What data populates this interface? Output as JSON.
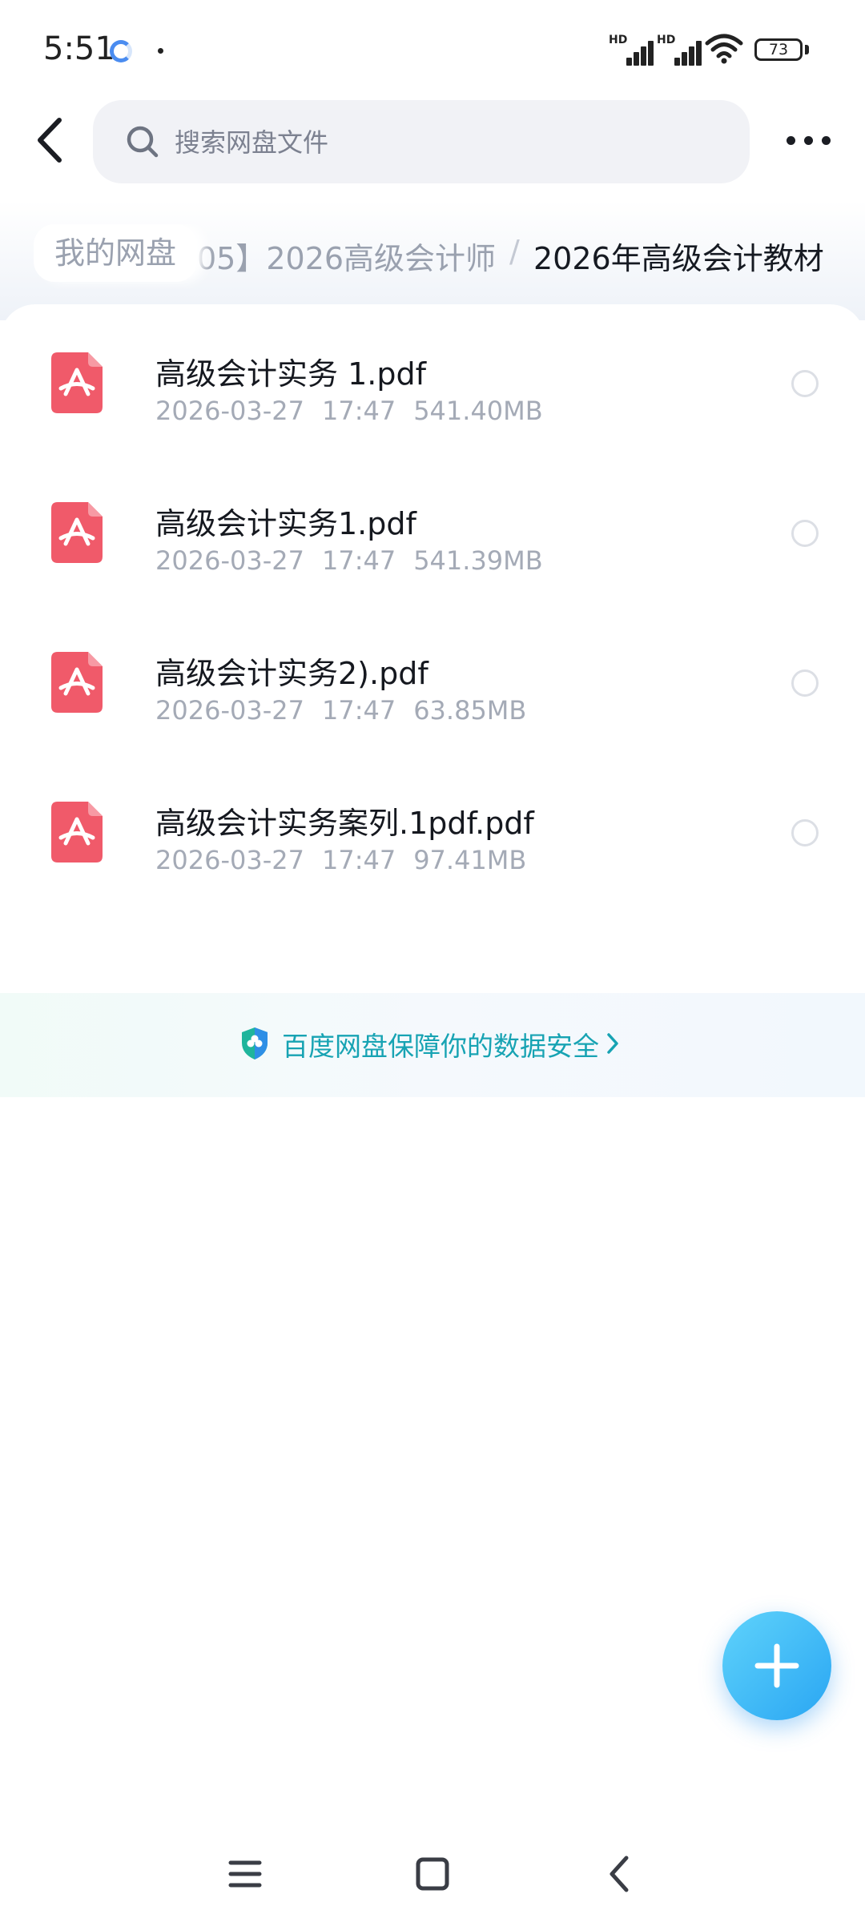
{
  "status_bar": {
    "time": "5:51",
    "signal_1_label": "HD",
    "signal_2_label": "HD",
    "battery": "73",
    "icons": [
      "loading-ring-icon",
      "notification-dot-icon",
      "signal-icon",
      "signal-icon",
      "wifi-icon",
      "battery-icon"
    ]
  },
  "header": {
    "back_icon": "chevron-left-icon",
    "search_placeholder": "搜索网盘文件",
    "search_icon": "search-icon",
    "more_icon": "more-horizontal-icon"
  },
  "breadcrumb": {
    "root": "我的网盘",
    "middle": "05】2026高级会计师",
    "separator": "/",
    "current": "2026年高级会计教材"
  },
  "files": [
    {
      "name": "高级会计实务 1.pdf",
      "date": "2026-03-27",
      "time": "17:47",
      "size": "541.40MB",
      "icon": "pdf-icon"
    },
    {
      "name": "高级会计实务1.pdf",
      "date": "2026-03-27",
      "time": "17:47",
      "size": "541.39MB",
      "icon": "pdf-icon"
    },
    {
      "name": "高级会计实务2).pdf",
      "date": "2026-03-27",
      "time": "17:47",
      "size": "63.85MB",
      "icon": "pdf-icon"
    },
    {
      "name": "高级会计实务案列.1pdf.pdf",
      "date": "2026-03-27",
      "time": "17:47",
      "size": "97.41MB",
      "icon": "pdf-icon"
    }
  ],
  "security_banner": {
    "text": "百度网盘保障你的数据安全",
    "icon": "shield-icon",
    "chevron": "chevron-right-icon"
  },
  "fab": {
    "icon": "plus-icon"
  },
  "nav_bar": {
    "icons": [
      "menu-icon",
      "home-square-icon",
      "back-triangle-icon"
    ]
  },
  "colors": {
    "accent": "#2aa6f3",
    "pdf_red": "#f05a6a",
    "security_teal": "#17a3b3",
    "meta_gray": "#a4aab6",
    "search_bg": "#f1f2f6"
  }
}
